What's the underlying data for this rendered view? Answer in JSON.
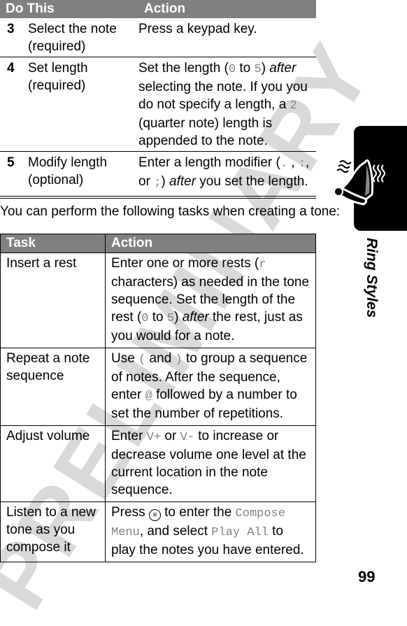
{
  "watermark": "PRELIMINARY",
  "steps_table": {
    "headers": [
      "Do This",
      "Action"
    ],
    "rows": [
      {
        "num": "3",
        "do": "Select the note (required)",
        "action": [
          "Press a keypad key."
        ]
      },
      {
        "num": "4",
        "do": "Set length (required)",
        "action_parts": [
          "Set the length (",
          "0",
          " to ",
          "5",
          ") ",
          "after",
          " selecting the note. If you you do not specify a length, a ",
          "2",
          " (quarter note) length is appended to the note."
        ]
      },
      {
        "num": "5",
        "do": "Modify length (optional)",
        "action_parts": [
          "Enter a length modifier (",
          ".",
          " , ",
          ":",
          ", or ",
          ";",
          ") ",
          "after",
          " you set the length."
        ]
      }
    ]
  },
  "intro_text": "You can perform the following tasks when creating a tone:",
  "tasks_table": {
    "headers": [
      "Task",
      "Action"
    ],
    "rows": [
      {
        "task": "Insert a rest",
        "action_parts": [
          "Enter one or more rests (",
          "r",
          " characters) as needed in the tone sequence. Set the length of the rest (",
          "0",
          " to ",
          "5",
          ") ",
          "after",
          " the rest, just as you would for a note."
        ]
      },
      {
        "task": "Repeat a note sequence",
        "action_parts": [
          "Use ",
          "(",
          " and ",
          ")",
          " to group a sequence of notes. After the sequence, enter ",
          "@",
          " followed by a number to set the number of repetitions."
        ]
      },
      {
        "task": "Adjust volume",
        "action_parts": [
          "Enter ",
          "V+",
          " or ",
          "V-",
          " to increase or decrease volume one level at the current location in the note sequence."
        ]
      },
      {
        "task": "Listen to a new tone as you compose it",
        "action_parts": [
          "Press ",
          "menu-key-icon",
          " to enter the ",
          "Compose Menu",
          ", and select ",
          "Play All",
          " to play the notes you have entered."
        ]
      }
    ]
  },
  "sidebar": {
    "section_title": "Ring Styles",
    "icon": "ringing-bell-icon"
  },
  "page_number": "99"
}
